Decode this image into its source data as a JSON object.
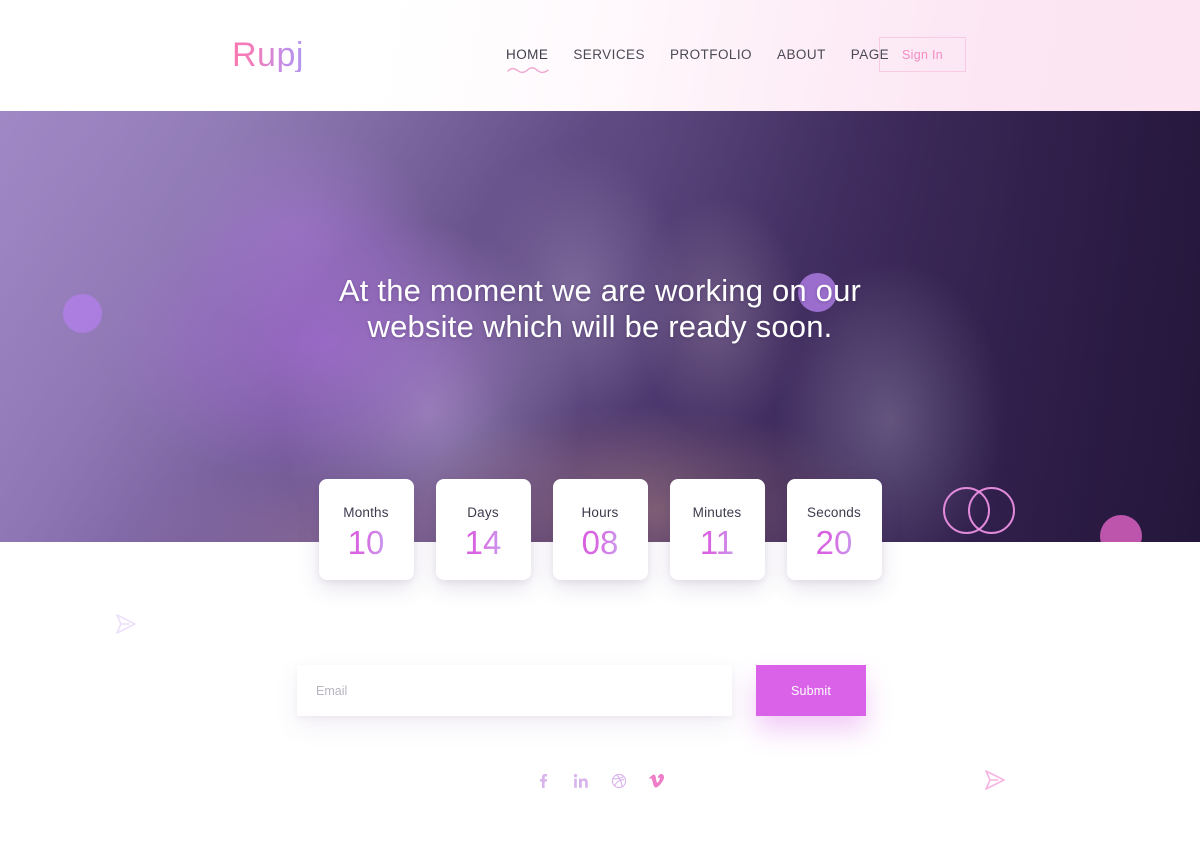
{
  "brand": {
    "name": "Rupj",
    "accent_pink": "#f978b0",
    "accent_purple": "#b497ee"
  },
  "header": {
    "nav": [
      {
        "label": "HOME",
        "active": true
      },
      {
        "label": "SERVICES",
        "active": false
      },
      {
        "label": "PROTFOLIO",
        "active": false
      },
      {
        "label": "ABOUT",
        "active": false
      },
      {
        "label": "PAGE",
        "active": false
      }
    ],
    "signin_label": "Sign In"
  },
  "hero": {
    "title_line1": "At the moment we are working on our",
    "title_line2": "website which will be ready soon."
  },
  "countdown": [
    {
      "label": "Months",
      "value": "10"
    },
    {
      "label": "Days",
      "value": "14"
    },
    {
      "label": "Hours",
      "value": "08"
    },
    {
      "label": "Minutes",
      "value": "11"
    },
    {
      "label": "Seconds",
      "value": "20"
    }
  ],
  "subscribe": {
    "email_placeholder": "Email",
    "email_value": "",
    "submit_label": "Submit"
  },
  "social": [
    {
      "name": "facebook-icon",
      "glyph": "f"
    },
    {
      "name": "linkedin-icon",
      "glyph": "in"
    },
    {
      "name": "dribbble-icon",
      "glyph": "⊛"
    },
    {
      "name": "vimeo-icon",
      "glyph": "v"
    }
  ],
  "colors": {
    "submit_bg": "#d962e8",
    "count_value": "#d65be0",
    "signin_text": "#f48cc4",
    "social": "#d9b3ec",
    "social_vimeo": "#ef7ec9"
  }
}
